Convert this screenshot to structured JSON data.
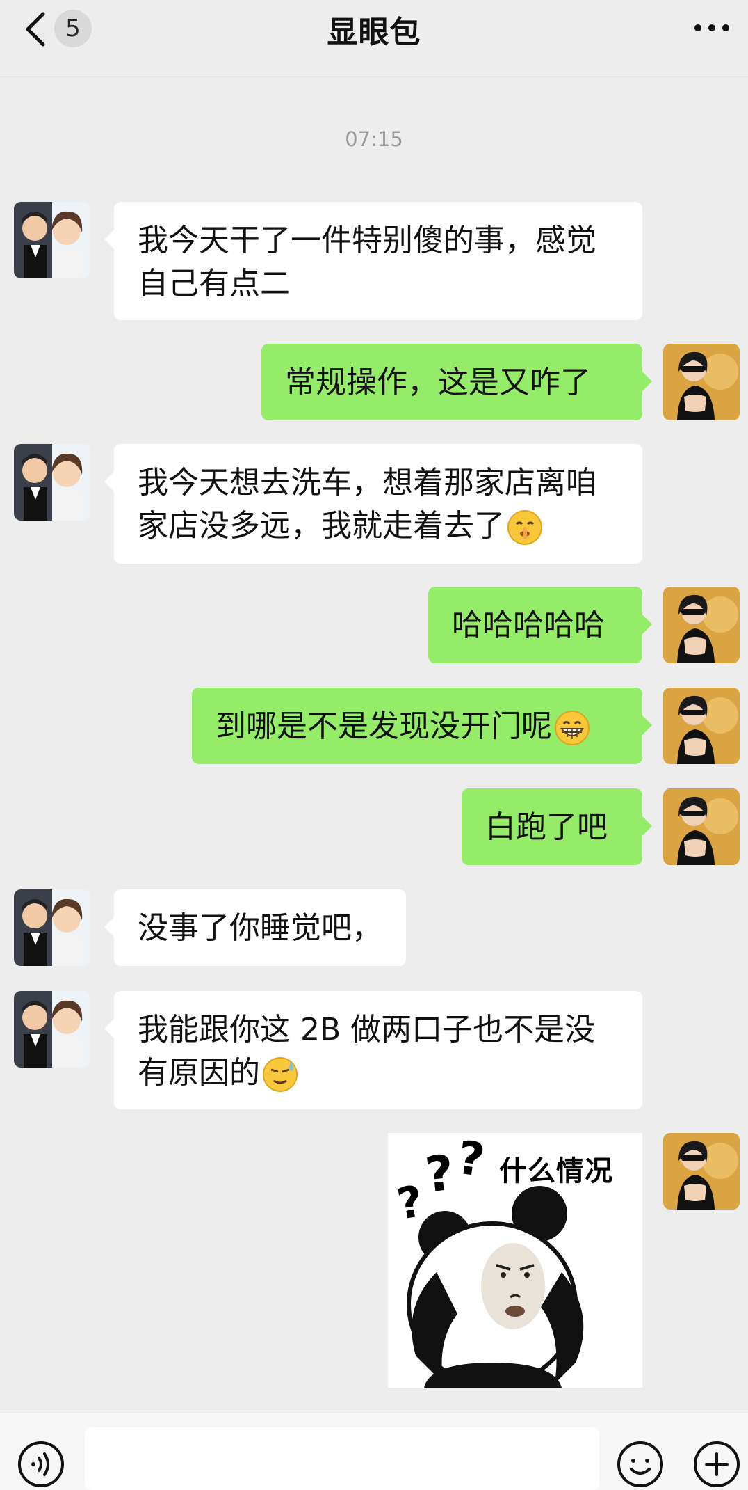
{
  "header": {
    "back_icon": "chevron-left-icon",
    "unread_count": "5",
    "title": "显眼包",
    "more_icon": "more-dots-icon"
  },
  "timestamp": "07:15",
  "messages": [
    {
      "side": "in",
      "avatar": "couple-avatar",
      "lines": [
        "我今天干了一件特别傻的事，感觉",
        "自己有点二"
      ]
    },
    {
      "side": "out",
      "avatar": "user-avatar",
      "lines": [
        "常规操作，这是又咋了"
      ]
    },
    {
      "side": "in",
      "avatar": "couple-avatar",
      "lines": [
        "我今天想去洗车，想着那家店离咱",
        "家店没多远，我就走着去了"
      ],
      "emoji": "shushing-face-emoji"
    },
    {
      "side": "out",
      "avatar": "user-avatar",
      "lines": [
        "哈哈哈哈哈"
      ]
    },
    {
      "side": "out",
      "avatar": "user-avatar",
      "lines": [
        "到哪是不是发现没开门呢"
      ],
      "emoji": "grinning-face-emoji"
    },
    {
      "side": "out",
      "avatar": "user-avatar",
      "lines": [
        "白跑了吧"
      ]
    },
    {
      "side": "in",
      "avatar": "couple-avatar",
      "lines": [
        "没事了你睡觉吧，"
      ]
    },
    {
      "side": "in",
      "avatar": "couple-avatar",
      "lines": [
        "我能跟你这 2B 做两口子也不是没",
        "有原因的"
      ],
      "emoji": "sweat-smile-emoji"
    }
  ],
  "sticker": {
    "side": "out",
    "caption": "什么情况",
    "marks": "???",
    "icon": "panda-meme-sticker"
  },
  "input_bar": {
    "voice_icon": "voice-icon",
    "emoji_icon": "emoji-icon",
    "plus_icon": "plus-icon"
  }
}
